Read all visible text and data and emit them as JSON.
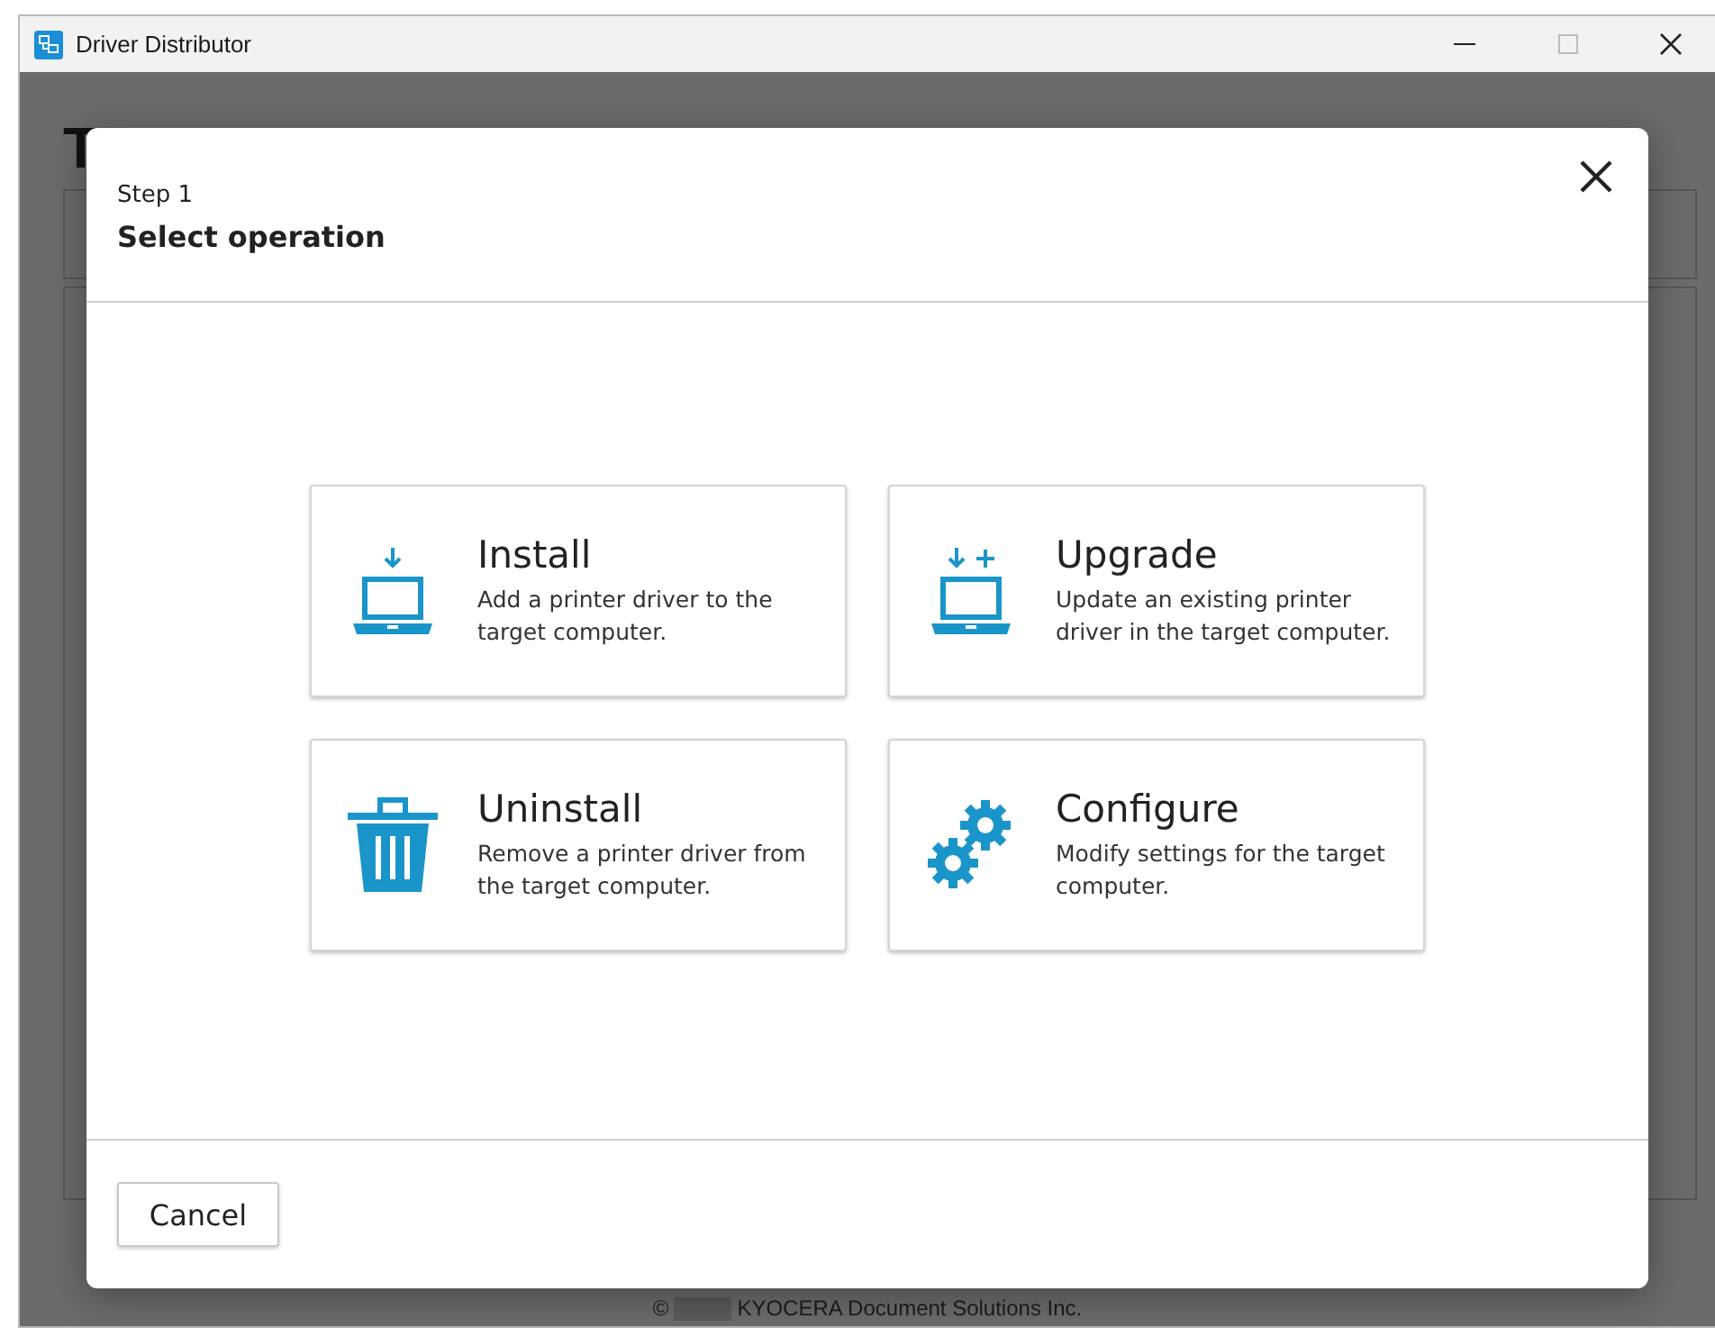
{
  "window": {
    "title": "Driver Distributor"
  },
  "background": {
    "page_title": "T",
    "footer": {
      "copyright": "©",
      "company": "KYOCERA Document Solutions Inc."
    }
  },
  "dialog": {
    "step": "Step 1",
    "title": "Select operation",
    "operations": [
      {
        "kind": "install",
        "title": "Install",
        "description": "Add a printer driver to the target computer."
      },
      {
        "kind": "upgrade",
        "title": "Upgrade",
        "description": "Update an existing printer driver in the target computer."
      },
      {
        "kind": "uninstall",
        "title": "Uninstall",
        "description": "Remove a printer driver from the target computer."
      },
      {
        "kind": "configure",
        "title": "Configure",
        "description": "Modify settings for the target computer."
      }
    ],
    "buttons": [
      "Cancel"
    ]
  }
}
